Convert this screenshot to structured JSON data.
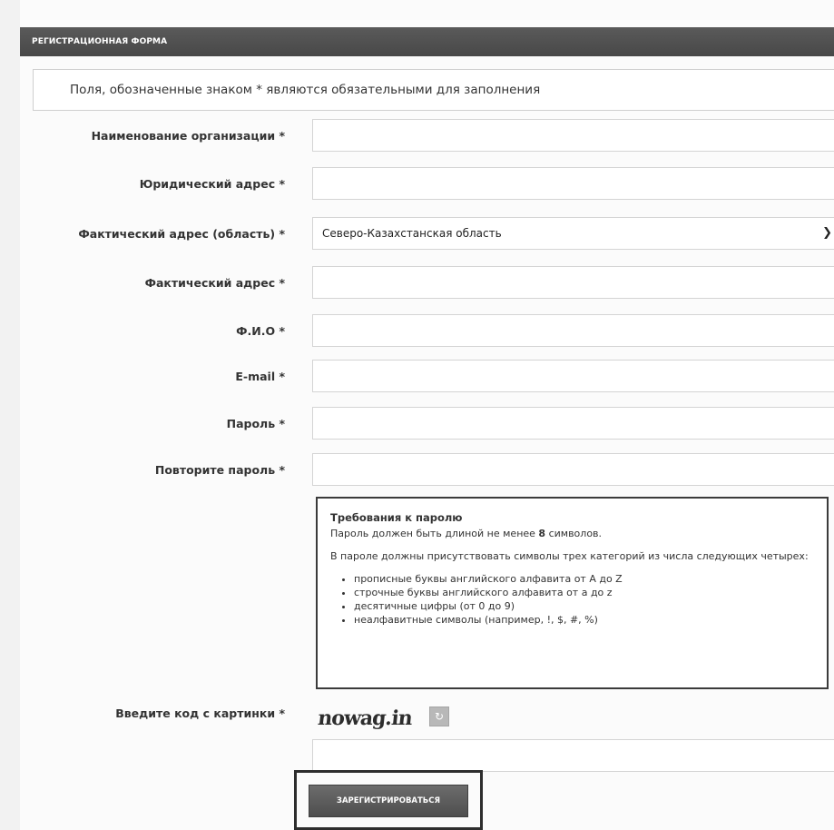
{
  "form": {
    "header": "РЕГИСТРАЦИОННАЯ ФОРМА",
    "notice": "Поля, обозначенные знаком * являются обязательными для заполнения",
    "fields": [
      {
        "label": "Наименование организации *",
        "value": ""
      },
      {
        "label": "Юридический адрес *",
        "value": ""
      },
      {
        "label": "Фактический адрес (область) *",
        "value": "Северо-Казахстанская область"
      },
      {
        "label": "Фактический адрес *",
        "value": ""
      },
      {
        "label": "Ф.И.О *",
        "value": ""
      },
      {
        "label": "E-mail *",
        "value": ""
      },
      {
        "label": "Пароль *",
        "value": ""
      },
      {
        "label": "Повторите пароль *",
        "value": ""
      }
    ],
    "password_requirements": {
      "title": "Требования к паролю",
      "length_text_before": "Пароль должен быть длиной не менее ",
      "length_number": "8",
      "length_text_after": " символов.",
      "categories_text": "В пароле должны присутствовать символы трех категорий из числа следующих четырех:",
      "items": [
        "прописные буквы английского алфавита от A до Z",
        "строчные буквы английского алфавита от a до z",
        "десятичные цифры (от 0 до 9)",
        "неалфавитные символы (например, !, $, #, %)"
      ]
    },
    "captcha": {
      "label": "Введите код с картинки *",
      "image_text": "nowag.in",
      "value": ""
    },
    "submit_label": "ЗАРЕГИСТРИРОВАТЬСЯ"
  }
}
